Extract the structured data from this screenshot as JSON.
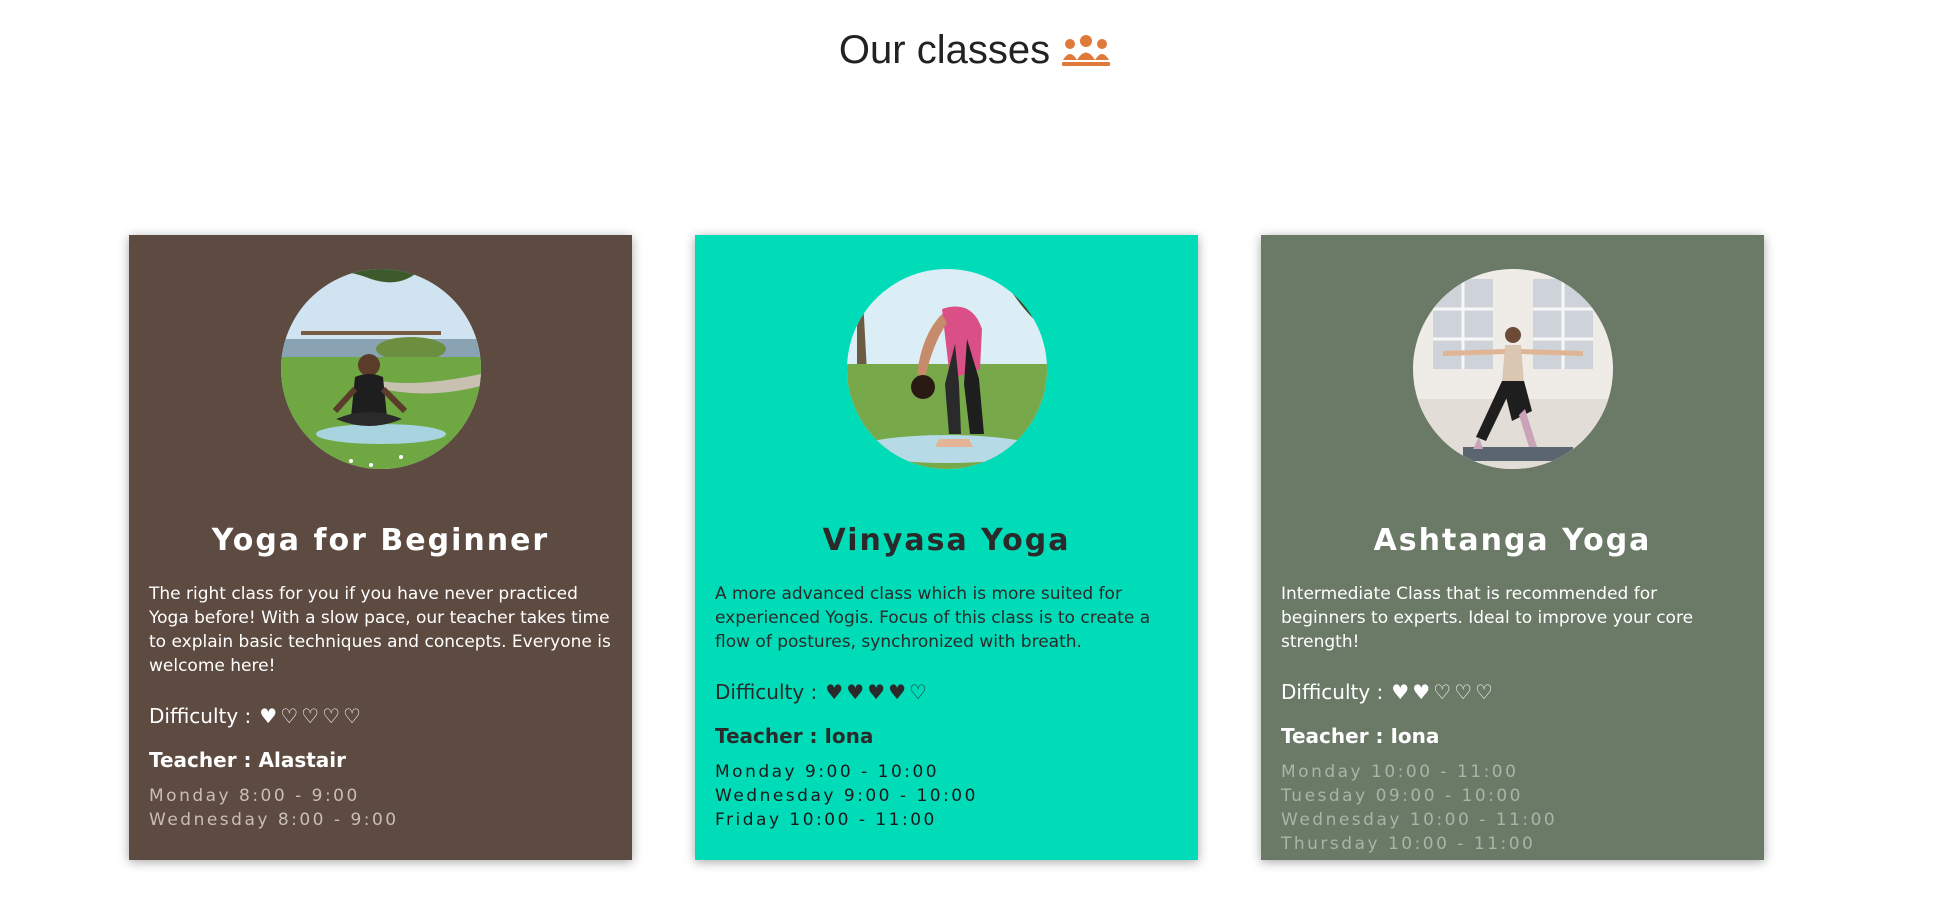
{
  "page": {
    "title": "Our classes",
    "title_icon": "group-people-icon",
    "accent_color": "#e07a3a"
  },
  "classes": [
    {
      "name": "Yoga for Beginner",
      "description": "The right class for you if you have never practiced Yoga before! With a slow pace, our teacher takes time to explain basic techniques and concepts. Everyone is welcome here!",
      "difficulty_label": "Difficulty :",
      "difficulty_level": 1,
      "difficulty_max": 5,
      "teacher": "Teacher : Alastair",
      "schedule": [
        "Monday 8:00 - 9:00",
        "Wednesday 8:00 - 9:00"
      ],
      "background_color": "#5d4a40",
      "photo": "man-meditating-on-grass-photo"
    },
    {
      "name": "Vinyasa Yoga",
      "description": "A more advanced class which is more suited for experienced Yogis. Focus of this class is to create a flow of postures, synchronized with breath.",
      "difficulty_label": "Difficulty :",
      "difficulty_level": 4,
      "difficulty_max": 5,
      "teacher": "Teacher : Iona",
      "schedule": [
        "Monday 9:00 - 10:00",
        "Wednesday 9:00 - 10:00",
        "Friday 10:00 - 11:00"
      ],
      "background_color": "#00dbb8",
      "photo": "woman-forward-fold-photo"
    },
    {
      "name": "Ashtanga Yoga",
      "description": "Intermediate Class that is recommended for beginners to experts. Ideal to improve your core strength!",
      "difficulty_label": "Difficulty :",
      "difficulty_level": 2,
      "difficulty_max": 5,
      "teacher": "Teacher : Iona",
      "schedule": [
        "Monday 10:00 - 11:00",
        "Tuesday 09:00 - 10:00",
        "Wednesday 10:00 - 11:00",
        "Thursday 10:00 - 11:00"
      ],
      "background_color": "#6a7a67",
      "photo": "woman-warrior-pose-photo"
    }
  ]
}
